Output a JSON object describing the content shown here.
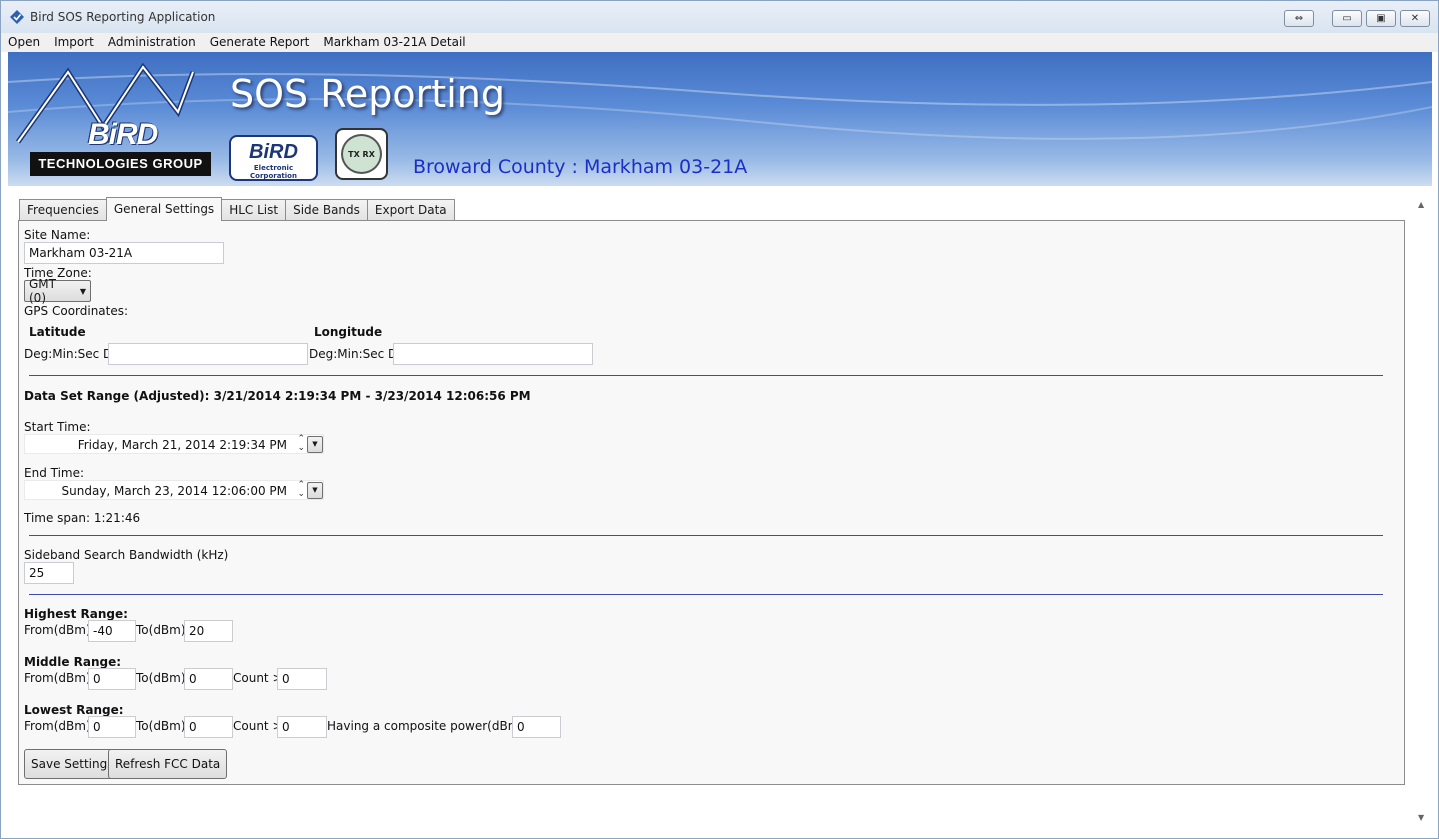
{
  "window": {
    "title": "Bird SOS Reporting Application",
    "buttons": {
      "special": "⇔",
      "minimize": "▭",
      "maximize": "▣",
      "close": "✕"
    }
  },
  "menu": [
    "Open",
    "Import",
    "Administration",
    "Generate Report",
    "Markham 03-21A Detail"
  ],
  "banner": {
    "title": "SOS Reporting",
    "subtitle": "Broward County : Markham 03-21A",
    "logo_tech_group": "TECHNOLOGIES GROUP",
    "logo_bird_large": "BiRD",
    "logo_bird_electronic": "BiRD",
    "logo_bird_electronic_sub": "Electronic Corporation",
    "logo_txrx": "TX RX"
  },
  "tabs": [
    "Frequencies",
    "General Settings",
    "HLC List",
    "Side Bands",
    "Export Data"
  ],
  "active_tab": "General Settings",
  "form": {
    "site_name_label": "Site Name:",
    "site_name_value": "Markham 03-21A",
    "time_zone_label": "Time Zone:",
    "time_zone_value": "GMT (0)",
    "gps_label": "GPS Coordinates:",
    "latitude_label": "Latitude",
    "longitude_label": "Longitude",
    "lat_dms_label": "Deg:Min:Sec Dir",
    "lat_value": "",
    "lon_dms_label": "Deg:Min:Sec Dir",
    "lon_value": "",
    "data_set_range": "Data Set Range (Adjusted): 3/21/2014 2:19:34 PM - 3/23/2014 12:06:56 PM",
    "start_time_label": "Start Time:",
    "start_time_value": "Friday, March 21, 2014 2:19:34 PM",
    "end_time_label": "End Time:",
    "end_time_value": "Sunday, March 23, 2014 12:06:00 PM",
    "time_span": "Time span: 1:21:46",
    "sideband_label": "Sideband Search Bandwidth (kHz)",
    "sideband_value": "25",
    "highest_label": "Highest Range:",
    "middle_label": "Middle Range:",
    "lowest_label": "Lowest Range:",
    "from_label": "From(dBm):",
    "to_label": "To(dBm):",
    "count_label": "Count >",
    "composite_label": "Having a composite power(dBm) >",
    "highest_from": "-40",
    "highest_to": "20",
    "middle_from": "0",
    "middle_to": "0",
    "middle_count": "0",
    "lowest_from": "0",
    "lowest_to": "0",
    "lowest_count": "0",
    "lowest_composite": "0",
    "save_button": "Save Settings",
    "refresh_button": "Refresh FCC Data"
  }
}
